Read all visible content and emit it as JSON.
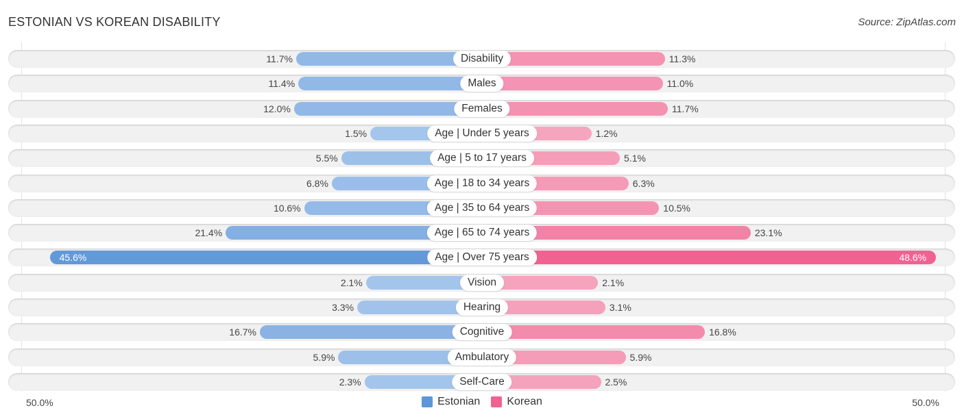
{
  "chart_data": {
    "type": "bar",
    "orientation": "horizontal-diverging",
    "title": "ESTONIAN VS KOREAN DISABILITY",
    "source": "Source: ZipAtlas.com",
    "categories": [
      "Disability",
      "Males",
      "Females",
      "Age | Under 5 years",
      "Age | 5 to 17 years",
      "Age | 18 to 34 years",
      "Age | 35 to 64 years",
      "Age | 65 to 74 years",
      "Age | Over 75 years",
      "Vision",
      "Hearing",
      "Cognitive",
      "Ambulatory",
      "Self-Care"
    ],
    "series": [
      {
        "name": "Estonian",
        "color": "#5e96d8",
        "values": [
          11.7,
          11.4,
          12.0,
          1.5,
          5.5,
          6.8,
          10.6,
          21.4,
          45.6,
          2.1,
          3.3,
          16.7,
          5.9,
          2.3
        ]
      },
      {
        "name": "Korean",
        "color": "#f06292",
        "values": [
          11.3,
          11.0,
          11.7,
          1.2,
          5.1,
          6.3,
          10.5,
          23.1,
          48.6,
          2.1,
          3.1,
          16.8,
          5.9,
          2.5
        ]
      }
    ],
    "value_labels": {
      "Estonian": [
        "11.7%",
        "11.4%",
        "12.0%",
        "1.5%",
        "5.5%",
        "6.8%",
        "10.6%",
        "21.4%",
        "45.6%",
        "2.1%",
        "3.3%",
        "16.7%",
        "5.9%",
        "2.3%"
      ],
      "Korean": [
        "11.3%",
        "11.0%",
        "11.7%",
        "1.2%",
        "5.1%",
        "6.3%",
        "10.5%",
        "23.1%",
        "48.6%",
        "2.1%",
        "3.1%",
        "16.8%",
        "5.9%",
        "2.5%"
      ]
    },
    "axis": {
      "left_label": "50.0%",
      "right_label": "50.0%",
      "xlim": [
        -50,
        50
      ]
    },
    "legend": {
      "position": "bottom-center",
      "entries": [
        "Estonian",
        "Korean"
      ]
    },
    "grid": false
  }
}
